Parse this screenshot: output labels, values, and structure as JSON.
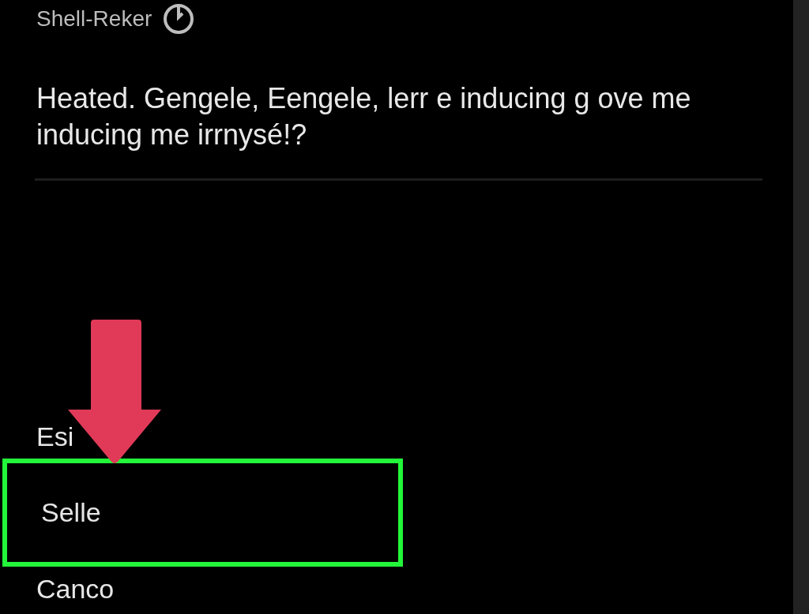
{
  "dialog": {
    "title": "Shell-Reker",
    "question": "Heated. Gengele, Eengele, lerr e inducing g ove me inducing me irrnysé!?"
  },
  "options": [
    {
      "label": "Esi",
      "selected": false
    },
    {
      "label": "Selle",
      "selected": true
    },
    {
      "label": "Canco",
      "selected": false
    }
  ]
}
